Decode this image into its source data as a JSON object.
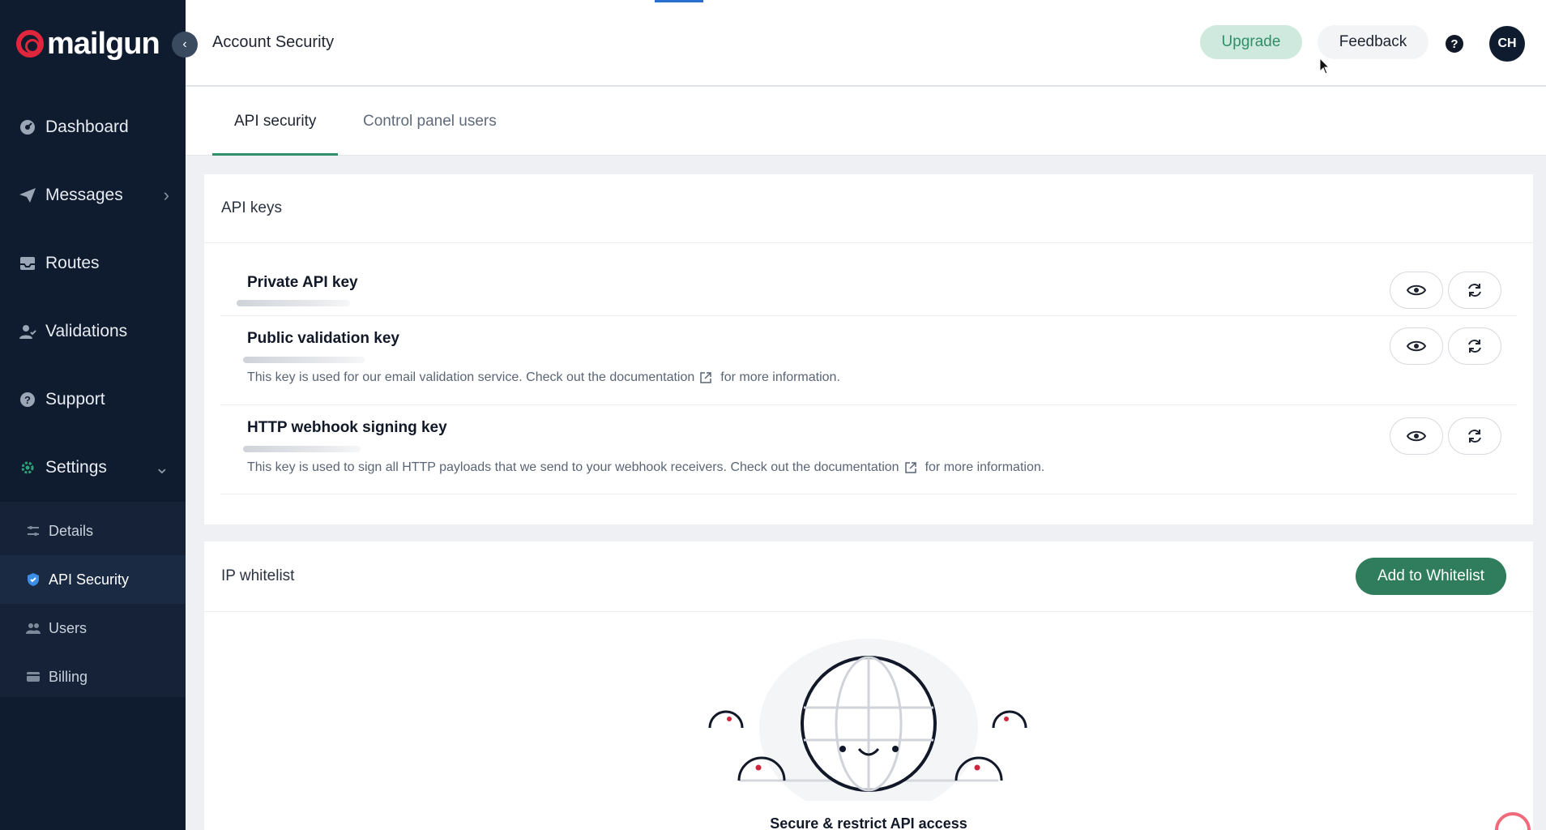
{
  "app": {
    "brand": "mailgun"
  },
  "sidebar": {
    "items": [
      {
        "label": "Dashboard",
        "icon": "dashboard-icon"
      },
      {
        "label": "Messages",
        "icon": "send-icon",
        "has_chevron": true
      },
      {
        "label": "Routes",
        "icon": "inbox-icon"
      },
      {
        "label": "Validations",
        "icon": "user-check-icon"
      },
      {
        "label": "Support",
        "icon": "help-circle-icon"
      },
      {
        "label": "Settings",
        "icon": "gear-icon",
        "expanded": true
      }
    ],
    "sub_items": [
      {
        "label": "Details",
        "icon": "sliders-icon"
      },
      {
        "label": "API Security",
        "icon": "shield-icon",
        "active": true
      },
      {
        "label": "Users",
        "icon": "users-icon"
      },
      {
        "label": "Billing",
        "icon": "card-icon"
      }
    ]
  },
  "header": {
    "title": "Account Security",
    "upgrade_label": "Upgrade",
    "feedback_label": "Feedback",
    "help_glyph": "?",
    "avatar_initials": "CH"
  },
  "tabs": [
    {
      "label": "API security",
      "active": true
    },
    {
      "label": "Control panel users",
      "active": false
    }
  ],
  "api_keys": {
    "heading": "API keys",
    "keys": [
      {
        "title": "Private API key",
        "description": null
      },
      {
        "title": "Public validation key",
        "description": "This key is used for our email validation service. Check out the documentation",
        "description_suffix": "for more information."
      },
      {
        "title": "HTTP webhook signing key",
        "description": "This key is used to sign all HTTP payloads that we send to your webhook receivers. Check out the documentation",
        "description_suffix": "for more information."
      }
    ]
  },
  "ip_whitelist": {
    "heading": "IP whitelist",
    "add_label": "Add to Whitelist",
    "empty_title": "Secure & restrict API access"
  },
  "colors": {
    "sidebar_bg": "#0f1b2e",
    "accent_green": "#2f7d5d",
    "brand_red": "#e0263d"
  }
}
